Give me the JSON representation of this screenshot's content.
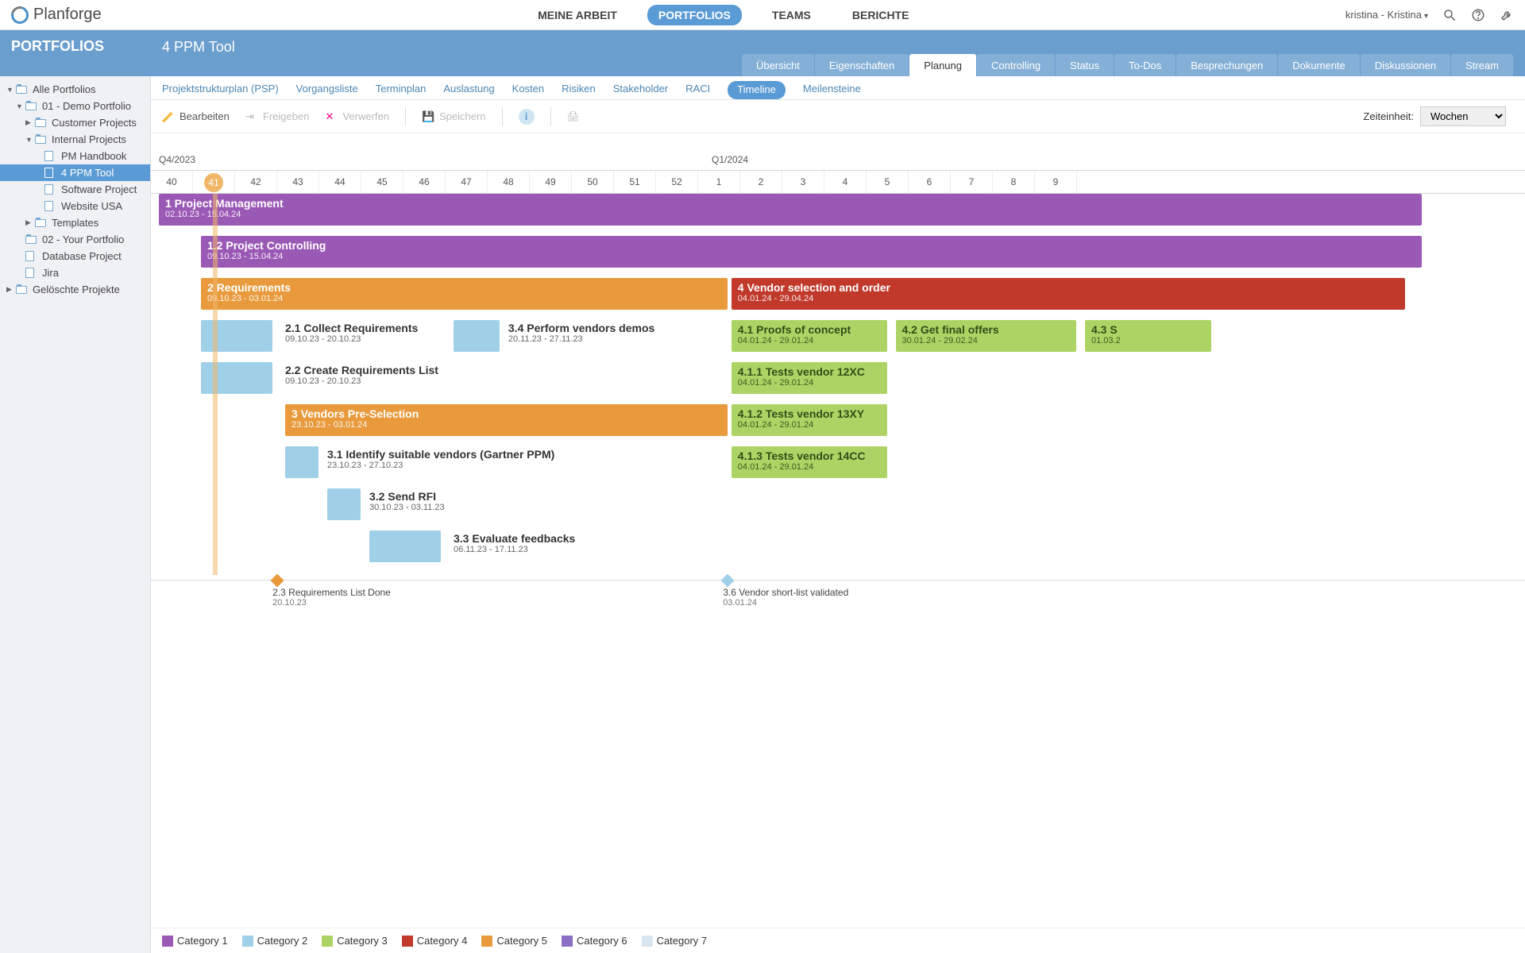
{
  "brand": "Planforge",
  "nav": {
    "arbeit": "MEINE ARBEIT",
    "portfolios": "PORTFOLIOS",
    "teams": "TEAMS",
    "berichte": "BERICHTE"
  },
  "user": "kristina - Kristina",
  "banner": {
    "left": "PORTFOLIOS",
    "title": "4 PPM Tool"
  },
  "tabs": [
    "Übersicht",
    "Eigenschaften",
    "Planung",
    "Controlling",
    "Status",
    "To-Dos",
    "Besprechungen",
    "Dokumente",
    "Diskussionen",
    "Stream"
  ],
  "active_tab": "Planung",
  "subtabs": [
    "Projektstrukturplan (PSP)",
    "Vorgangsliste",
    "Terminplan",
    "Auslastung",
    "Kosten",
    "Risiken",
    "Stakeholder",
    "RACI",
    "Timeline",
    "Meilensteine"
  ],
  "active_subtab": "Timeline",
  "tools": {
    "bearbeiten": "Bearbeiten",
    "freigeben": "Freigeben",
    "verwerfen": "Verwerfen",
    "speichern": "Speichern"
  },
  "zeiteinheit": {
    "label": "Zeiteinheit:",
    "value": "Wochen"
  },
  "tree": [
    {
      "label": "Alle Portfolios",
      "indent": 0,
      "expanded": true,
      "icon": "folder"
    },
    {
      "label": "01 - Demo Portfolio",
      "indent": 1,
      "expanded": true,
      "icon": "folder"
    },
    {
      "label": "Customer Projects",
      "indent": 2,
      "expanded": false,
      "icon": "folder",
      "leaf": false
    },
    {
      "label": "Internal Projects",
      "indent": 2,
      "expanded": true,
      "icon": "folder",
      "leaf": false
    },
    {
      "label": "PM Handbook",
      "indent": 3,
      "icon": "doc",
      "leaf": true
    },
    {
      "label": "4 PPM Tool",
      "indent": 3,
      "icon": "doc",
      "leaf": true,
      "selected": true
    },
    {
      "label": "Software Project",
      "indent": 3,
      "icon": "doc",
      "leaf": true
    },
    {
      "label": "Website USA",
      "indent": 3,
      "icon": "doc",
      "leaf": true
    },
    {
      "label": "Templates",
      "indent": 2,
      "expanded": false,
      "icon": "folder",
      "leaf": false
    },
    {
      "label": "02 - Your Portfolio",
      "indent": 1,
      "icon": "folder",
      "leaf": true
    },
    {
      "label": "Database Project",
      "indent": 1,
      "icon": "doc",
      "leaf": true
    },
    {
      "label": "Jira",
      "indent": 1,
      "icon": "doc",
      "leaf": true
    },
    {
      "label": "Gelöschte Projekte",
      "indent": 0,
      "expanded": false,
      "icon": "folder",
      "leaf": false
    }
  ],
  "quarters": [
    "Q4/2023",
    "Q1/2024"
  ],
  "weeks": [
    "40",
    "41",
    "42",
    "43",
    "44",
    "45",
    "46",
    "47",
    "48",
    "49",
    "50",
    "51",
    "52",
    "1",
    "2",
    "3",
    "4",
    "5",
    "6",
    "7",
    "8",
    "9"
  ],
  "current_week": "41",
  "bars": {
    "b1": {
      "t": "1 Project Management",
      "d": "02.10.23 - 15.04.24"
    },
    "b2": {
      "t": "1.2 Project Controlling",
      "d": "09.10.23 - 15.04.24"
    },
    "b3": {
      "t": "2 Requirements",
      "d": "09.10.23 - 03.01.24"
    },
    "b4": {
      "t": "4 Vendor selection and order",
      "d": "04.01.24 - 29.04.24"
    },
    "b5": {
      "t": "4.1 Proofs of concept",
      "d": "04.01.24 - 29.01.24"
    },
    "b6": {
      "t": "4.2 Get final offers",
      "d": "30.01.24 - 29.02.24"
    },
    "b7": {
      "t": "4.3 S",
      "d": "01.03.2"
    },
    "b8": {
      "t": "4.1.1 Tests vendor 12XC",
      "d": "04.01.24 - 29.01.24"
    },
    "b9": {
      "t": "4.1.2 Tests vendor 13XY",
      "d": "04.01.24 - 29.01.24"
    },
    "b10": {
      "t": "4.1.3 Tests vendor 14CC",
      "d": "04.01.24 - 29.01.24"
    },
    "b11": {
      "t": "3 Vendors Pre-Selection",
      "d": "23.10.23 - 03.01.24"
    }
  },
  "tasks": {
    "t1": {
      "t": "2.1 Collect Requirements",
      "d": "09.10.23 - 20.10.23"
    },
    "t2": {
      "t": "3.4 Perform vendors demos",
      "d": "20.11.23 - 27.11.23"
    },
    "t3": {
      "t": "2.2 Create Requirements List",
      "d": "09.10.23 - 20.10.23"
    },
    "t4": {
      "t": "3.1 Identify suitable vendors (Gartner PPM)",
      "d": "23.10.23 - 27.10.23"
    },
    "t5": {
      "t": "3.2 Send RFI",
      "d": "30.10.23 - 03.11.23"
    },
    "t6": {
      "t": "3.3 Evaluate feedbacks",
      "d": "06.11.23 - 17.11.23"
    }
  },
  "milestones": {
    "m1": {
      "t": "2.3 Requirements List Done",
      "d": "20.10.23"
    },
    "m2": {
      "t": "3.6 Vendor short-list validated",
      "d": "03.01.24"
    }
  },
  "legend": [
    {
      "label": "Category 1",
      "color": "#9b59b6"
    },
    {
      "label": "Category 2",
      "color": "#a0d0e8"
    },
    {
      "label": "Category 3",
      "color": "#aed365"
    },
    {
      "label": "Category 4",
      "color": "#c0392b"
    },
    {
      "label": "Category 5",
      "color": "#e89a3c"
    },
    {
      "label": "Category 6",
      "color": "#8d6ec7"
    },
    {
      "label": "Category 7",
      "color": "#d9e5ee"
    }
  ]
}
